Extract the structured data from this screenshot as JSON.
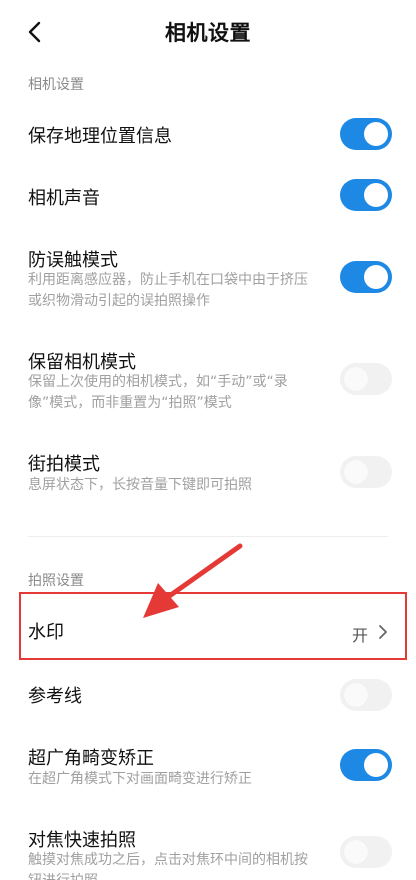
{
  "header": {
    "title": "相机设置",
    "back_icon": "chevron-left-icon"
  },
  "sections": {
    "camera": "相机设置",
    "photo": "拍照设置"
  },
  "items": {
    "geo": {
      "label": "保存地理位置信息",
      "on": true
    },
    "sound": {
      "label": "相机声音",
      "on": true
    },
    "anti": {
      "label": "防误触模式",
      "desc": "利用距离感应器，防止手机在口袋中由于挤压或织物滑动引起的误拍照操作",
      "on": true
    },
    "keep": {
      "label": "保留相机模式",
      "desc": "保留上次使用的相机模式，如“手动”或“录像”模式，而非重置为“拍照”模式",
      "on": false
    },
    "street": {
      "label": "街拍模式",
      "desc": "息屏状态下，长按音量下键即可拍照",
      "on": false
    },
    "watermark": {
      "label": "水印",
      "value": "开"
    },
    "grid": {
      "label": "参考线",
      "on": false
    },
    "ultra": {
      "label": "超广角畸变矫正",
      "desc": "在超广角模式下对画面畸变进行矫正",
      "on": true
    },
    "focus": {
      "label": "对焦快速拍照",
      "desc": "触摸对焦成功之后，点击对焦环中间的相机按钮进行拍照"
    }
  },
  "colors": {
    "accent": "#1e88e5",
    "highlight": "#e53935"
  }
}
